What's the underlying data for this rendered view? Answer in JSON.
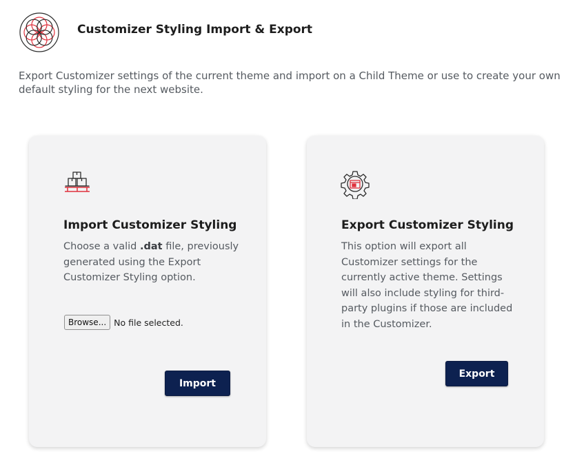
{
  "header": {
    "title": "Customizer Styling Import & Export",
    "logo_icon": "rosette-logo-icon"
  },
  "intro": "Export Customizer settings of the current theme and import on a Child Theme or use to create your own default styling for the next website.",
  "import_card": {
    "icon": "boxes-on-pallet-icon",
    "title": "Import Customizer Styling",
    "desc_before": "Choose a valid ",
    "desc_bold": ".dat",
    "desc_after": " file, previously generated using the Export Customizer Styling option.",
    "browse_label": "Browse...",
    "file_status": "No file selected.",
    "button_label": "Import"
  },
  "export_card": {
    "icon": "gear-with-window-icon",
    "title": "Export Customizer Styling",
    "description": "This option will export all Customizer settings for the currently active theme. Settings will also include styling for third-party plugins if those are included in the Customizer.",
    "button_label": "Export"
  },
  "colors": {
    "accent_red": "#e0313d",
    "button_navy": "#0d2150",
    "card_bg": "#f3f3f4"
  }
}
